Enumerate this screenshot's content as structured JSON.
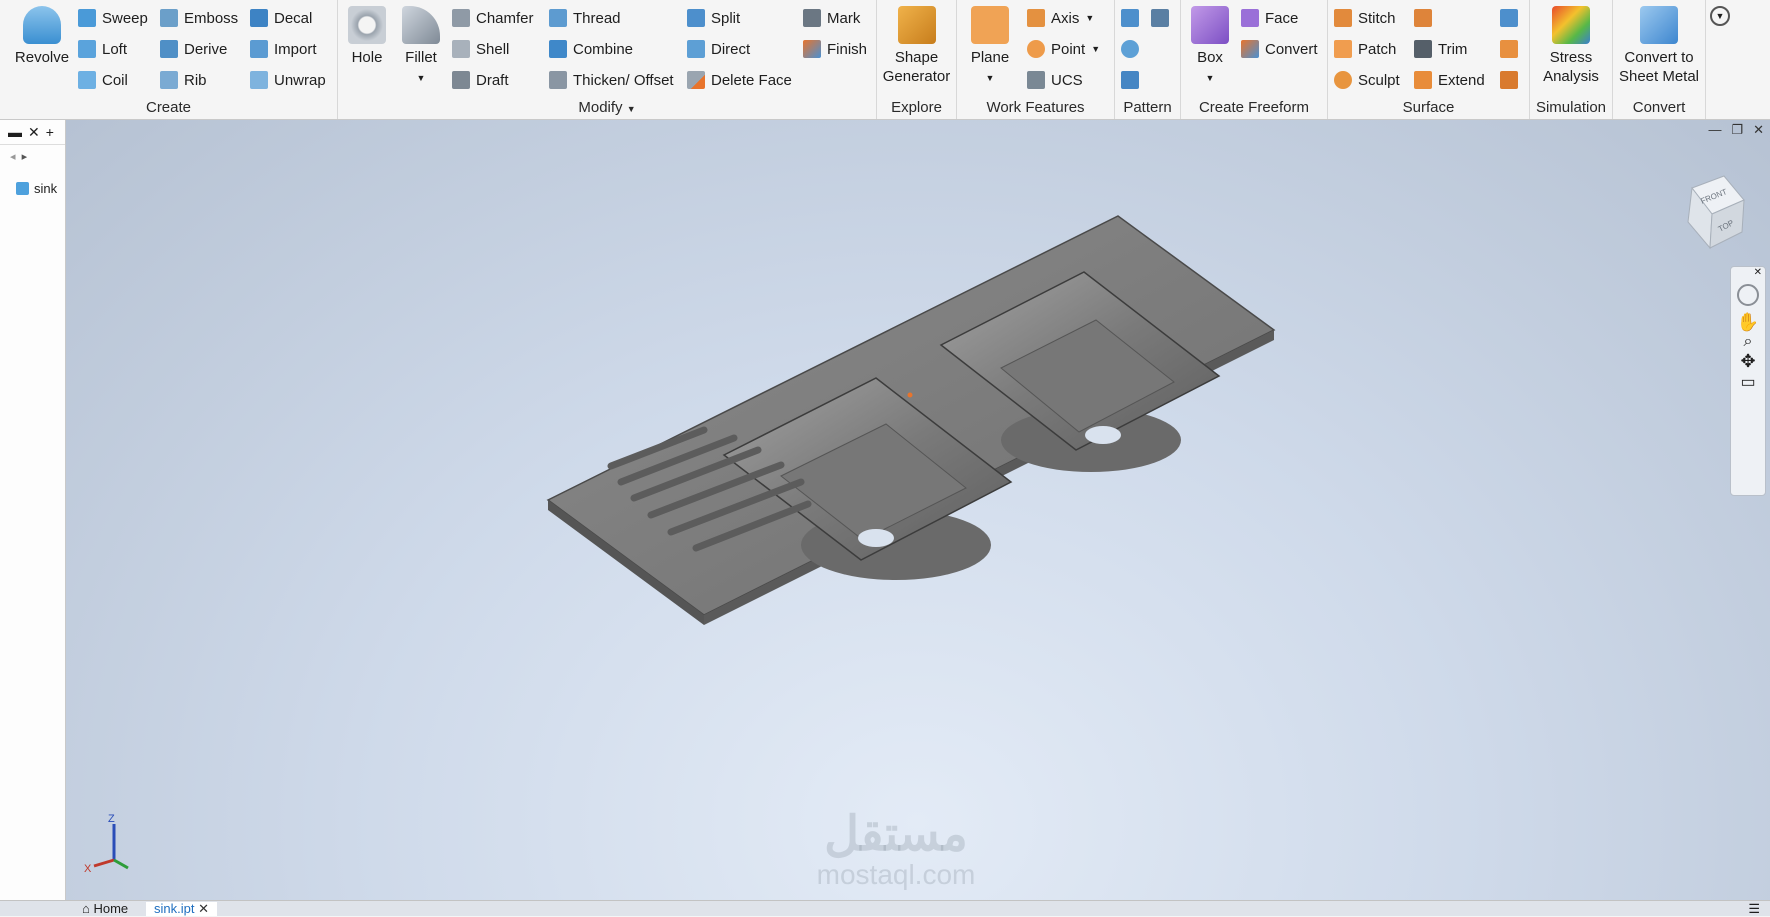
{
  "ribbon": {
    "create": {
      "title": "Create",
      "revolve": "Revolve",
      "col1": [
        "Sweep",
        "Loft",
        "Coil"
      ],
      "col2": [
        "Emboss",
        "Derive",
        "Rib"
      ],
      "col3": [
        "Decal",
        "Import",
        "Unwrap"
      ]
    },
    "modify": {
      "title": "Modify",
      "hole": "Hole",
      "fillet": "Fillet",
      "col1": [
        "Chamfer",
        "Shell",
        "Draft"
      ],
      "col2": [
        "Thread",
        "Combine",
        "Thicken/ Offset"
      ],
      "col3": [
        "Split",
        "Direct",
        "Delete Face"
      ],
      "col4": [
        "Mark",
        "Finish"
      ]
    },
    "explore": {
      "title": "Explore",
      "shape_generator": [
        "Shape",
        "Generator"
      ]
    },
    "work_features": {
      "title": "Work Features",
      "plane": "Plane",
      "items": [
        "Axis",
        "Point",
        "UCS"
      ]
    },
    "pattern": {
      "title": "Pattern"
    },
    "create_freeform": {
      "title": "Create Freeform",
      "box": "Box",
      "items": [
        "Face",
        "Convert"
      ]
    },
    "surface": {
      "title": "Surface",
      "col1": [
        "Stitch",
        "Patch",
        "Sculpt"
      ],
      "col2": [
        "Trim",
        "Extend"
      ]
    },
    "simulation": {
      "title": "Simulation",
      "stress": [
        "Stress",
        "Analysis"
      ]
    },
    "convert": {
      "title": "Convert",
      "sheet_metal": [
        "Convert to",
        "Sheet Metal"
      ]
    }
  },
  "browser": {
    "item": "sink"
  },
  "tabs": {
    "home": "Home",
    "doc": "sink.ipt"
  },
  "viewcube": {
    "front": "FRONT",
    "top": "TOP"
  },
  "axes": {
    "z": "Z",
    "x": "X"
  },
  "watermark": {
    "arabic": "مستقل",
    "latin": "mostaql.com"
  }
}
